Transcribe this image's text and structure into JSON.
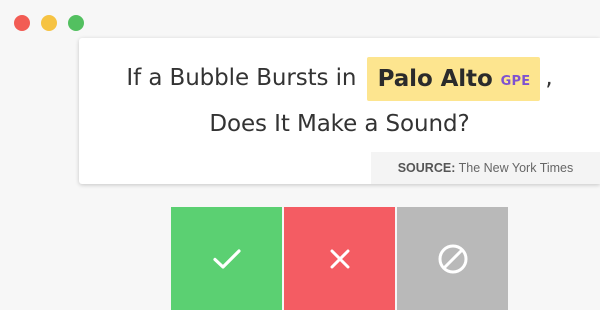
{
  "window": {
    "controls": [
      "close",
      "minimize",
      "maximize"
    ]
  },
  "headline": {
    "part1": "If a Bubble Bursts in",
    "entity_text": "Palo Alto",
    "entity_label": "GPE",
    "part2": ",",
    "line2": "Does It Make a Sound?"
  },
  "source": {
    "label": "SOURCE:",
    "value": "The New York Times"
  },
  "actions": [
    {
      "name": "accept",
      "icon": "check-icon",
      "color": "#5bd072"
    },
    {
      "name": "reject",
      "icon": "x-icon",
      "color": "#f45c63"
    },
    {
      "name": "ignore",
      "icon": "ban-icon",
      "color": "#b9b9b9"
    }
  ],
  "colors": {
    "entity_highlight": "#fde58f",
    "entity_label": "#7f52d0",
    "text": "#333333"
  }
}
